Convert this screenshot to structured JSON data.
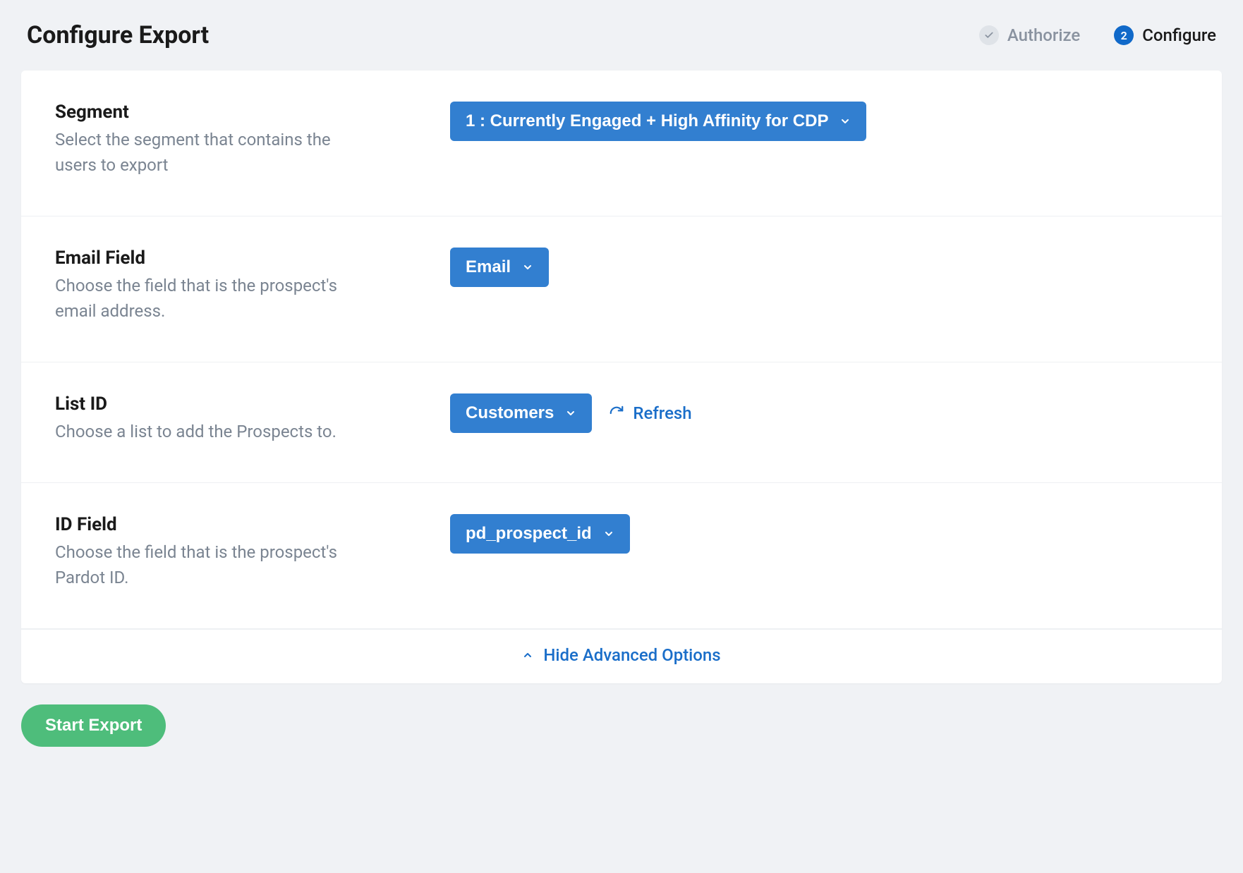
{
  "header": {
    "title": "Configure Export",
    "steps": {
      "authorize": {
        "label": "Authorize"
      },
      "configure": {
        "number": "2",
        "label": "Configure"
      }
    }
  },
  "fields": {
    "segment": {
      "title": "Segment",
      "desc": "Select the segment that contains the users to export",
      "value": "1 : Currently Engaged + High Affinity for CDP"
    },
    "email_field": {
      "title": "Email Field",
      "desc": "Choose the field that is the prospect's email address.",
      "value": "Email"
    },
    "list_id": {
      "title": "List ID",
      "desc": "Choose a list to add the Prospects to.",
      "value": "Customers",
      "refresh_label": "Refresh"
    },
    "id_field": {
      "title": "ID Field",
      "desc": "Choose the field that is the prospect's Pardot ID.",
      "value": "pd_prospect_id"
    }
  },
  "advanced_toggle": "Hide Advanced Options",
  "actions": {
    "start_export": "Start Export"
  }
}
